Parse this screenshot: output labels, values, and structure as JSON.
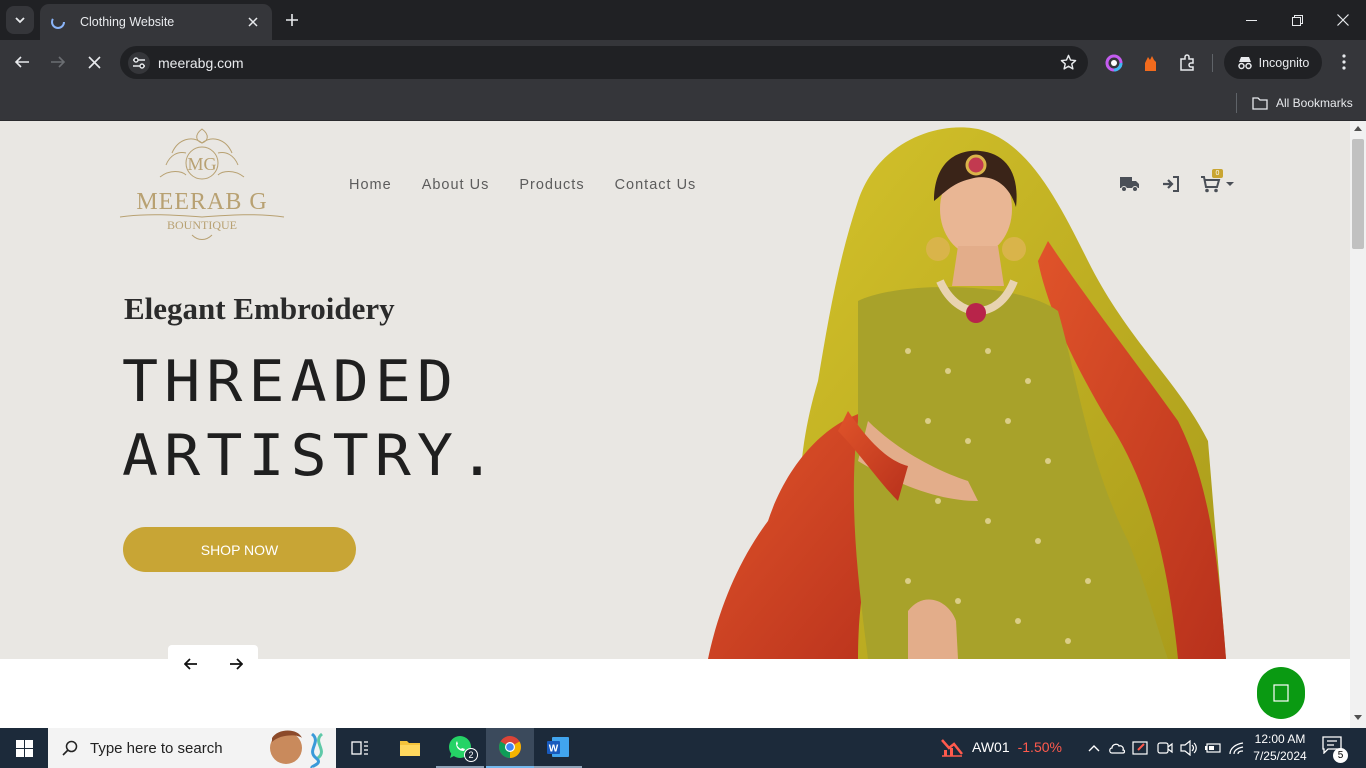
{
  "browser": {
    "tab_title": "Clothing Website",
    "url": "meerabg.com",
    "profile_label": "Incognito",
    "bookmarks_label": "All Bookmarks"
  },
  "site": {
    "logo": {
      "monogram": "MG",
      "brand": "MEERAB G",
      "tagline": "BOUNTIQUE"
    },
    "nav": [
      "Home",
      "About Us",
      "Products",
      "Contact Us"
    ],
    "cart_count": "0",
    "hero": {
      "subheading": "Elegant Embroidery",
      "heading_line1": "THREADED",
      "heading_line2": "ARTISTRY.",
      "cta": "SHOP NOW"
    },
    "colors": {
      "accent_gold": "#c8a535",
      "hero_bg": "#e9e7e3",
      "whatsapp_green": "#0a9a12"
    }
  },
  "taskbar": {
    "search_placeholder": "Type here to search",
    "whatsapp_badge": "2",
    "stock_symbol": "AW01",
    "stock_change": "-1.50%",
    "time": "12:00 AM",
    "date": "7/25/2024",
    "notification_count": "5"
  }
}
